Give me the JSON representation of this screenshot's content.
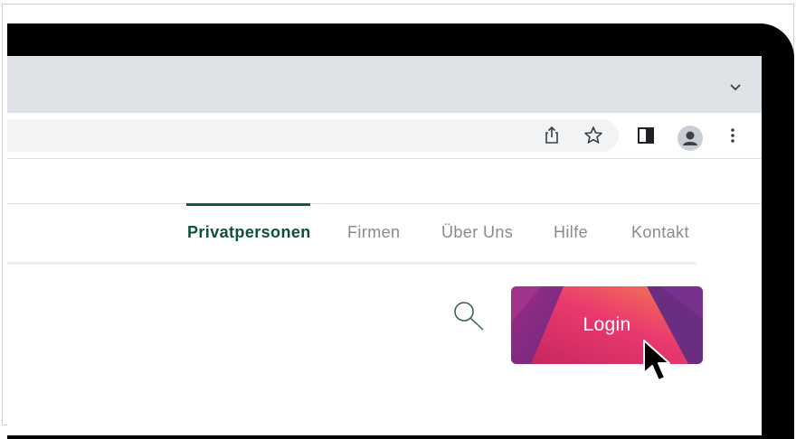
{
  "nav": {
    "items": [
      {
        "label": "Privatpersonen",
        "active": true
      },
      {
        "label": "Firmen",
        "active": false
      },
      {
        "label": "Über Uns",
        "active": false
      },
      {
        "label": "Hilfe",
        "active": false
      },
      {
        "label": "Kontakt",
        "active": false
      }
    ]
  },
  "login": {
    "label": "Login"
  },
  "icons": {
    "tabstrip": "chevron-down-icon",
    "toolbar": [
      "share-icon",
      "star-icon",
      "side-panel-icon",
      "profile-avatar-icon",
      "more-vert-icon"
    ],
    "site": [
      "search-icon",
      "mouse-cursor-icon"
    ]
  },
  "colors": {
    "nav_active": "#0f4f3f",
    "nav_inactive": "#8a8a8a",
    "login_gradient": [
      "#7a2d86",
      "#e8356f",
      "#f07a4a"
    ]
  }
}
